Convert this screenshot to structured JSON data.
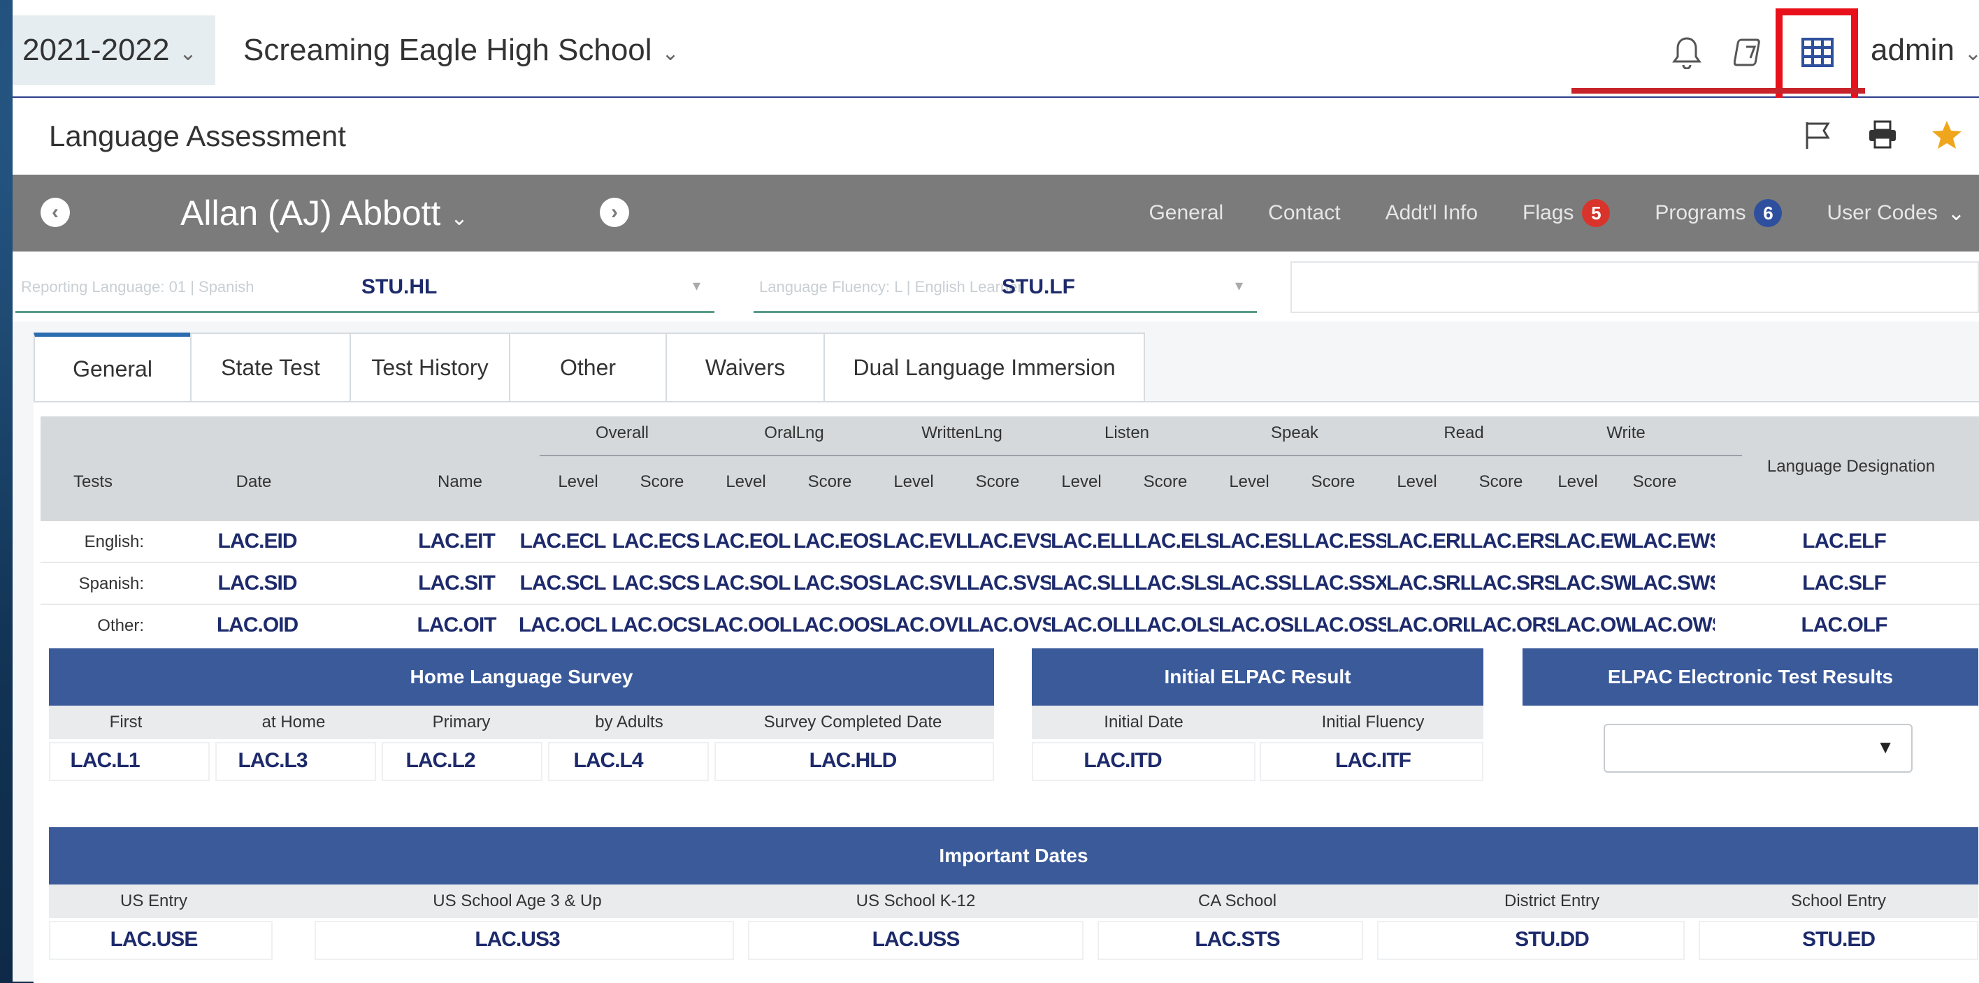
{
  "topbar": {
    "year": "2021-2022",
    "school": "Screaming Eagle High School",
    "user": "admin",
    "icons": [
      "bell-icon",
      "notes-icon",
      "grid-table-icon"
    ]
  },
  "page": {
    "title": "Language Assessment",
    "icons": [
      "flag-icon",
      "print-icon",
      "star-icon"
    ]
  },
  "student": {
    "name": "Allan (AJ) Abbott",
    "tabs": [
      {
        "label": "General"
      },
      {
        "label": "Contact"
      },
      {
        "label": "Addt'l Info"
      },
      {
        "label": "Flags",
        "badge": "5",
        "badge_color": "#d9342b"
      },
      {
        "label": "Programs",
        "badge": "6",
        "badge_color": "#2d4f9e"
      },
      {
        "label": "User Codes"
      }
    ]
  },
  "selects": {
    "reporting_faded": "Reporting Language: 01 | Spanish",
    "reporting_value": "STU.HL",
    "fluency_faded": "Language Fluency: L | English Learner",
    "fluency_value": "STU.LF"
  },
  "tabs": [
    "General",
    "State Test",
    "Test History",
    "Other",
    "Waivers",
    "Dual Language Immersion"
  ],
  "grid": {
    "groups": [
      "Overall",
      "OralLng",
      "WrittenLng",
      "Listen",
      "Speak",
      "Read",
      "Write"
    ],
    "headers": [
      "Tests",
      "Date",
      "Name",
      "Level",
      "Score",
      "Level",
      "Score",
      "Level",
      "Score",
      "Level",
      "Score",
      "Level",
      "Score",
      "Level",
      "Score",
      "Level",
      "Score"
    ],
    "designation_header": "Language Designation",
    "rows": [
      {
        "label": "English:",
        "cells": [
          "LAC.EID",
          "LAC.EIT",
          "LAC.ECL",
          "LAC.ECS",
          "LAC.EOL",
          "LAC.EOS",
          "LAC.EVL",
          "LAC.EVS",
          "LAC.ELL",
          "LAC.ELS",
          "LAC.ESL",
          "LAC.ESS",
          "LAC.ERL",
          "LAC.ERS",
          "LAC.EWL",
          "LAC.EWS",
          "LAC.ELF"
        ]
      },
      {
        "label": "Spanish:",
        "cells": [
          "LAC.SID",
          "LAC.SIT",
          "LAC.SCL",
          "LAC.SCS",
          "LAC.SOL",
          "LAC.SOS",
          "LAC.SVL",
          "LAC.SVS",
          "LAC.SLL",
          "LAC.SLS",
          "LAC.SSL",
          "LAC.SSX",
          "LAC.SRL",
          "LAC.SRS",
          "LAC.SWL",
          "LAC.SWS",
          "LAC.SLF"
        ]
      },
      {
        "label": "Other:",
        "cells": [
          "LAC.OID",
          "LAC.OIT",
          "LAC.OCL",
          "LAC.OCS",
          "LAC.OOL",
          "LAC.OOS",
          "LAC.OVL",
          "LAC.OVS",
          "LAC.OLL",
          "LAC.OLS",
          "LAC.OSL",
          "LAC.OSS",
          "LAC.ORL",
          "LAC.ORS",
          "LAC.OWL",
          "LAC.OWS",
          "LAC.OLF"
        ]
      }
    ]
  },
  "home_survey": {
    "title": "Home Language Survey",
    "headers": [
      "First",
      "at Home",
      "Primary",
      "by Adults",
      "Survey Completed Date"
    ],
    "values": [
      "LAC.L1",
      "LAC.L3",
      "LAC.L2",
      "LAC.L4",
      "LAC.HLD"
    ]
  },
  "elpac_initial": {
    "title": "Initial ELPAC Result",
    "headers": [
      "Initial Date",
      "Initial Fluency"
    ],
    "values": [
      "LAC.ITD",
      "LAC.ITF"
    ]
  },
  "elpac_electronic": {
    "title": "ELPAC Electronic Test Results",
    "select_value": ""
  },
  "important_dates": {
    "title": "Important Dates",
    "headers": [
      "US Entry",
      "US School Age 3 & Up",
      "US School K-12",
      "CA School",
      "District Entry",
      "School Entry"
    ],
    "values": [
      "LAC.USE",
      "LAC.US3",
      "LAC.USS",
      "LAC.STS",
      "STU.DD",
      "STU.ED"
    ]
  },
  "colors": {
    "header_blue": "#3b5a9a",
    "student_bar": "#7b7b7b",
    "highlight_red": "#e8111b",
    "code_text": "#1d2a6b"
  }
}
